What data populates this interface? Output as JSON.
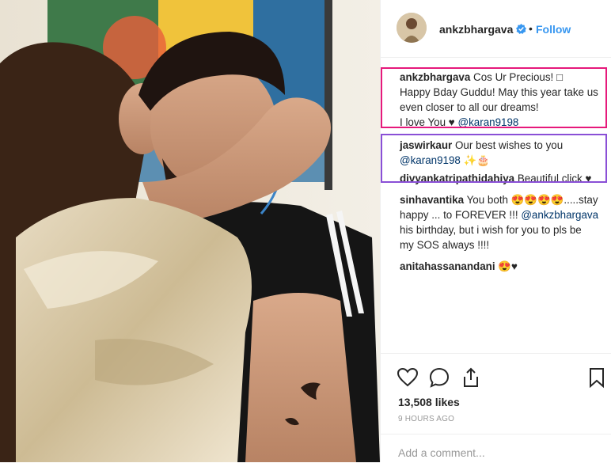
{
  "post": {
    "username": "ankzbhargava",
    "follow_label": "Follow",
    "separator": "•"
  },
  "caption": {
    "username": "ankzbhargava",
    "line1": "Cos Ur Precious! □",
    "line2": "Happy Bday Guddu! May this year take us",
    "line3": "even closer to all our dreams!",
    "line4": "I love You ♥",
    "mention": "@karan9198"
  },
  "comments": [
    {
      "username": "jaswirkaur",
      "text": "Our best wishes to you",
      "mention": "@karan9198",
      "trail": "✨🎂"
    },
    {
      "username": "divyankatripathidahiya",
      "text": "Beautiful click ♥"
    },
    {
      "username": "sinhavantika",
      "text": "You both 😍😍😍😍.....stay",
      "line2": "happy ... to FOREVER !!!",
      "mention": "@ankzbhargava",
      "line3": "his birthday, but i wish for you to pls be",
      "line4": "my SOS always !!!!"
    },
    {
      "username": "anitahassanandani",
      "text": "😍♥"
    }
  ],
  "likes": "13,508 likes",
  "timestamp": "9 HOURS AGO",
  "add_comment_placeholder": "Add a comment...",
  "colors": {
    "link": "#003569",
    "follow": "#3897f0",
    "highlight_caption": "#e6197b",
    "highlight_comments": "#8a4fd6",
    "meta": "#999999"
  },
  "icons": [
    "heart-icon",
    "comment-icon",
    "share-icon",
    "bookmark-icon",
    "verified-badge-icon"
  ]
}
